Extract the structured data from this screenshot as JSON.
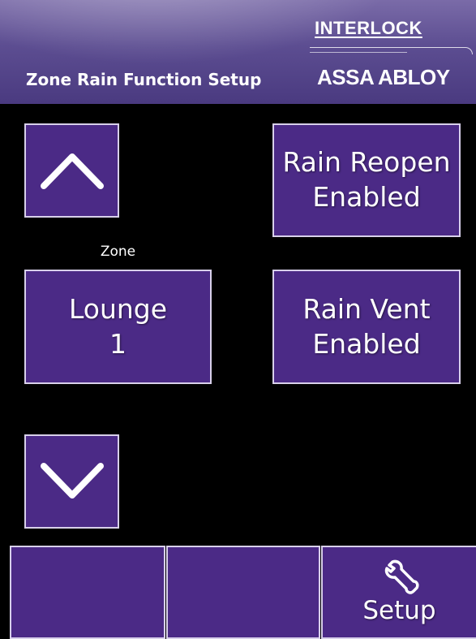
{
  "header": {
    "title": "Zone Rain Function Setup",
    "brand_top": "INTERLOCK",
    "brand_bottom": "ASSA ABLOY"
  },
  "controls": {
    "up_icon": "chevron-up-icon",
    "down_icon": "chevron-down-icon",
    "zone_caption": "Zone",
    "zone_name": "Lounge",
    "zone_number": "1",
    "rain_reopen_line1": "Rain Reopen",
    "rain_reopen_line2": "Enabled",
    "rain_vent_line1": "Rain Vent",
    "rain_vent_line2": "Enabled"
  },
  "footer": {
    "button1_label": "",
    "button2_label": "",
    "setup_label": "Setup",
    "setup_icon": "wrench-icon"
  },
  "colors": {
    "button_fill": "#4b2a86",
    "button_border": "#d8d0ea",
    "header_purple": "#5c4d91",
    "background": "#000000"
  }
}
